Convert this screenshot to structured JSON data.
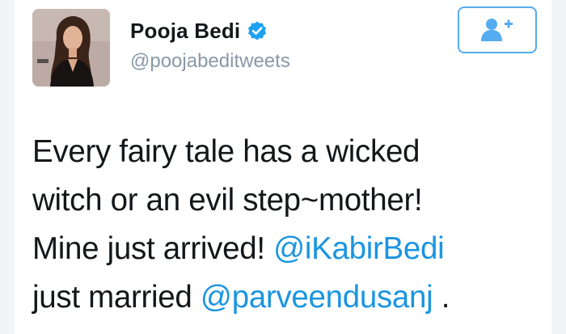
{
  "user": {
    "display_name": "Pooja Bedi",
    "handle": "@poojabeditweets",
    "verified": true,
    "avatar_icon": "profile-photo"
  },
  "follow_button": {
    "icon": "follow-user-plus-icon",
    "accent_color": "#55acee"
  },
  "tweet": {
    "line1": "Every fairy tale has a wicked",
    "line2": "witch or an evil step~mother!",
    "line3_text": "Mine just arrived! ",
    "line3_mention": "@iKabirBedi",
    "line4_text": "just married ",
    "line4_mention": "@parveendusanj",
    "line4_end": " ."
  },
  "colors": {
    "text": "#14171a",
    "handle": "#8899a6",
    "mention": "#1b95e0",
    "verified": "#1da1f2"
  }
}
